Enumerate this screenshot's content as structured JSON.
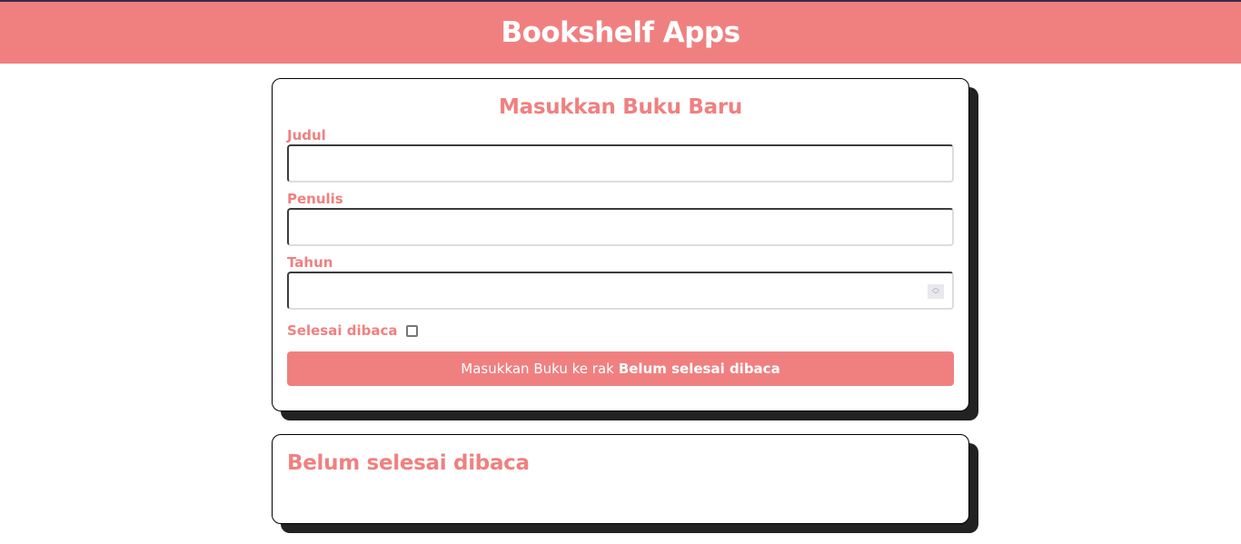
{
  "header": {
    "title": "Bookshelf Apps"
  },
  "input_section": {
    "title": "Masukkan Buku Baru",
    "fields": [
      {
        "label": "Judul",
        "value": ""
      },
      {
        "label": "Penulis",
        "value": ""
      },
      {
        "label": "Tahun",
        "value": ""
      }
    ],
    "complete_label": "Selesai dibaca",
    "complete_checked": false,
    "submit_prefix": "Masukkan Buku ke rak",
    "submit_target": "Belum selesai dibaca"
  },
  "incomplete_shelf": {
    "title": "Belum selesai dibaca"
  },
  "colors": {
    "accent": "#f08080",
    "shadow": "#222222"
  }
}
